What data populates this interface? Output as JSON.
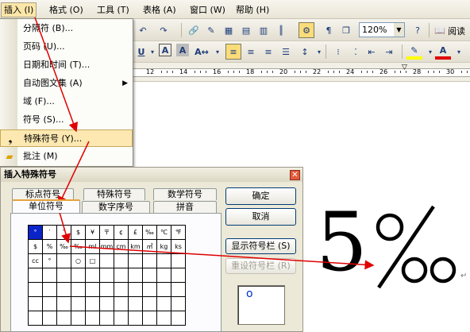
{
  "menubar": {
    "items": [
      "插入 (I)",
      "格式 (O)",
      "工具 (T)",
      "表格 (A)",
      "窗口 (W)",
      "帮助 (H)"
    ]
  },
  "toolbar": {
    "zoom": "120%",
    "read_label": "阅读"
  },
  "ruler": {
    "numbers": [
      "12",
      "14",
      "16",
      "18",
      "20",
      "22",
      "24",
      "26",
      "28",
      "30"
    ]
  },
  "insert_menu": {
    "items": [
      {
        "label": "分隔符 (B)..."
      },
      {
        "label": "页码 (U)..."
      },
      {
        "label": "日期和时间 (T)..."
      },
      {
        "label": "自动图文集 (A)"
      },
      {
        "label": "域 (F)..."
      },
      {
        "label": "符号 (S)..."
      },
      {
        "label": "特殊符号 (Y)..."
      },
      {
        "label": "批注 (M)"
      }
    ]
  },
  "dialog": {
    "title": "插入特殊符号",
    "close_glyph": "✕",
    "tabs": [
      "标点符号",
      "特殊符号",
      "数学符号",
      "单位符号",
      "数字序号",
      "拼音"
    ],
    "ok": "确定",
    "cancel": "取消",
    "show_bar": "显示符号栏 (S)",
    "reset_bar": "重设符号栏 (R)",
    "grid_rows": [
      [
        "°",
        "′",
        "″",
        "$",
        "¥",
        "〒",
        "¢",
        "£",
        "‰",
        "℃",
        "℉"
      ],
      [
        "$",
        "%",
        "‰",
        "‰",
        "ml",
        "mm",
        "cm",
        "km",
        "㎡",
        "kg",
        "ks"
      ],
      [
        "cc",
        "°",
        "",
        "○",
        "□",
        "",
        "",
        "",
        "",
        "",
        ""
      ],
      [
        "",
        "",
        "",
        "",
        "",
        "",
        "",
        "",
        "",
        "",
        ""
      ],
      [
        "",
        "",
        "",
        "",
        "",
        "",
        "",
        "",
        "",
        "",
        ""
      ],
      [
        "",
        "",
        "",
        "",
        "",
        "",
        "",
        "",
        "",
        "",
        ""
      ],
      [
        "",
        "",
        "",
        "",
        "",
        "",
        "",
        "",
        "",
        "",
        ""
      ]
    ],
    "preview_glyph": "o"
  },
  "document": {
    "digit": "5",
    "permille": "‰",
    "para_mark": "↵"
  }
}
